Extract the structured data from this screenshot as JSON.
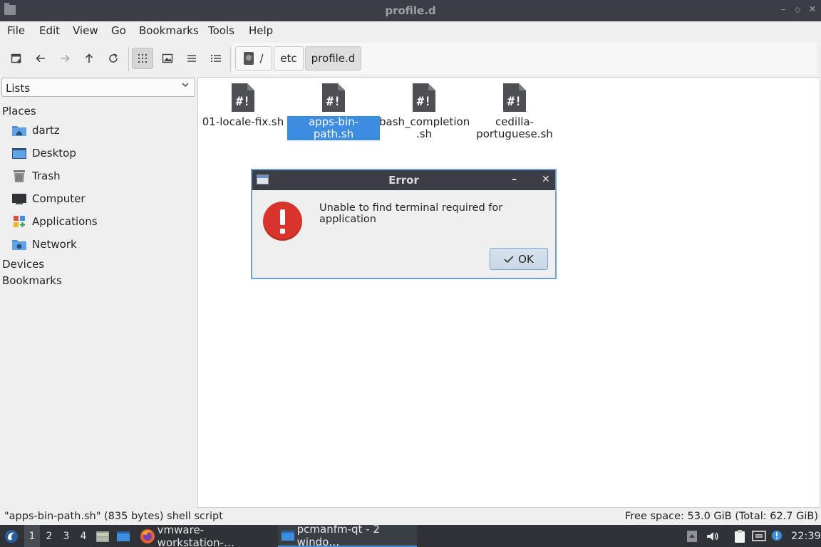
{
  "window": {
    "title": "profile.d"
  },
  "menu": [
    "File",
    "Edit",
    "View",
    "Go",
    "Bookmarks",
    "Tools",
    "Help"
  ],
  "toolbar": {
    "buttons": [
      "new-tab-icon",
      "back-icon",
      "forward-icon",
      "up-icon",
      "reload-icon",
      "icon-view-icon",
      "thumbnail-view-icon",
      "compact-view-icon",
      "detailed-list-icon"
    ],
    "breadcrumb": [
      "/",
      "etc",
      "profile.d"
    ]
  },
  "sidebar": {
    "view_select": "Lists",
    "places_label": "Places",
    "places": [
      {
        "label": "dartz",
        "icon": "home-folder-icon"
      },
      {
        "label": "Desktop",
        "icon": "desktop-icon"
      },
      {
        "label": "Trash",
        "icon": "trash-icon"
      },
      {
        "label": "Computer",
        "icon": "computer-icon"
      },
      {
        "label": "Applications",
        "icon": "applications-icon"
      },
      {
        "label": "Network",
        "icon": "network-icon"
      }
    ],
    "devices_label": "Devices",
    "bookmarks_label": "Bookmarks"
  },
  "files": [
    {
      "line1": "01-locale-fix.sh",
      "line2": ""
    },
    {
      "line1": "apps-bin-path.sh",
      "line2": "",
      "selected": true
    },
    {
      "line1": "bash_completion",
      "line2": ".sh"
    },
    {
      "line1": "cedilla-",
      "line2": "portuguese.sh"
    }
  ],
  "dialog": {
    "title": "Error",
    "message": "Unable to find terminal required for application",
    "ok_label": "OK",
    "minimize": "–",
    "close": "✕"
  },
  "status": {
    "left": "\"apps-bin-path.sh\" (835 bytes) shell script",
    "right": "Free space: 53.0 GiB (Total: 62.7 GiB)"
  },
  "taskbar": {
    "desktops": [
      "1",
      "2",
      "3",
      "4"
    ],
    "tasks": [
      "vmware-workstation-…",
      "pcmanfm-qt - 2 windo…"
    ],
    "clock": "22:39"
  },
  "colors": {
    "accent": "#3d8ee0",
    "error": "#d9342b",
    "titlebar": "#3b3e45"
  }
}
